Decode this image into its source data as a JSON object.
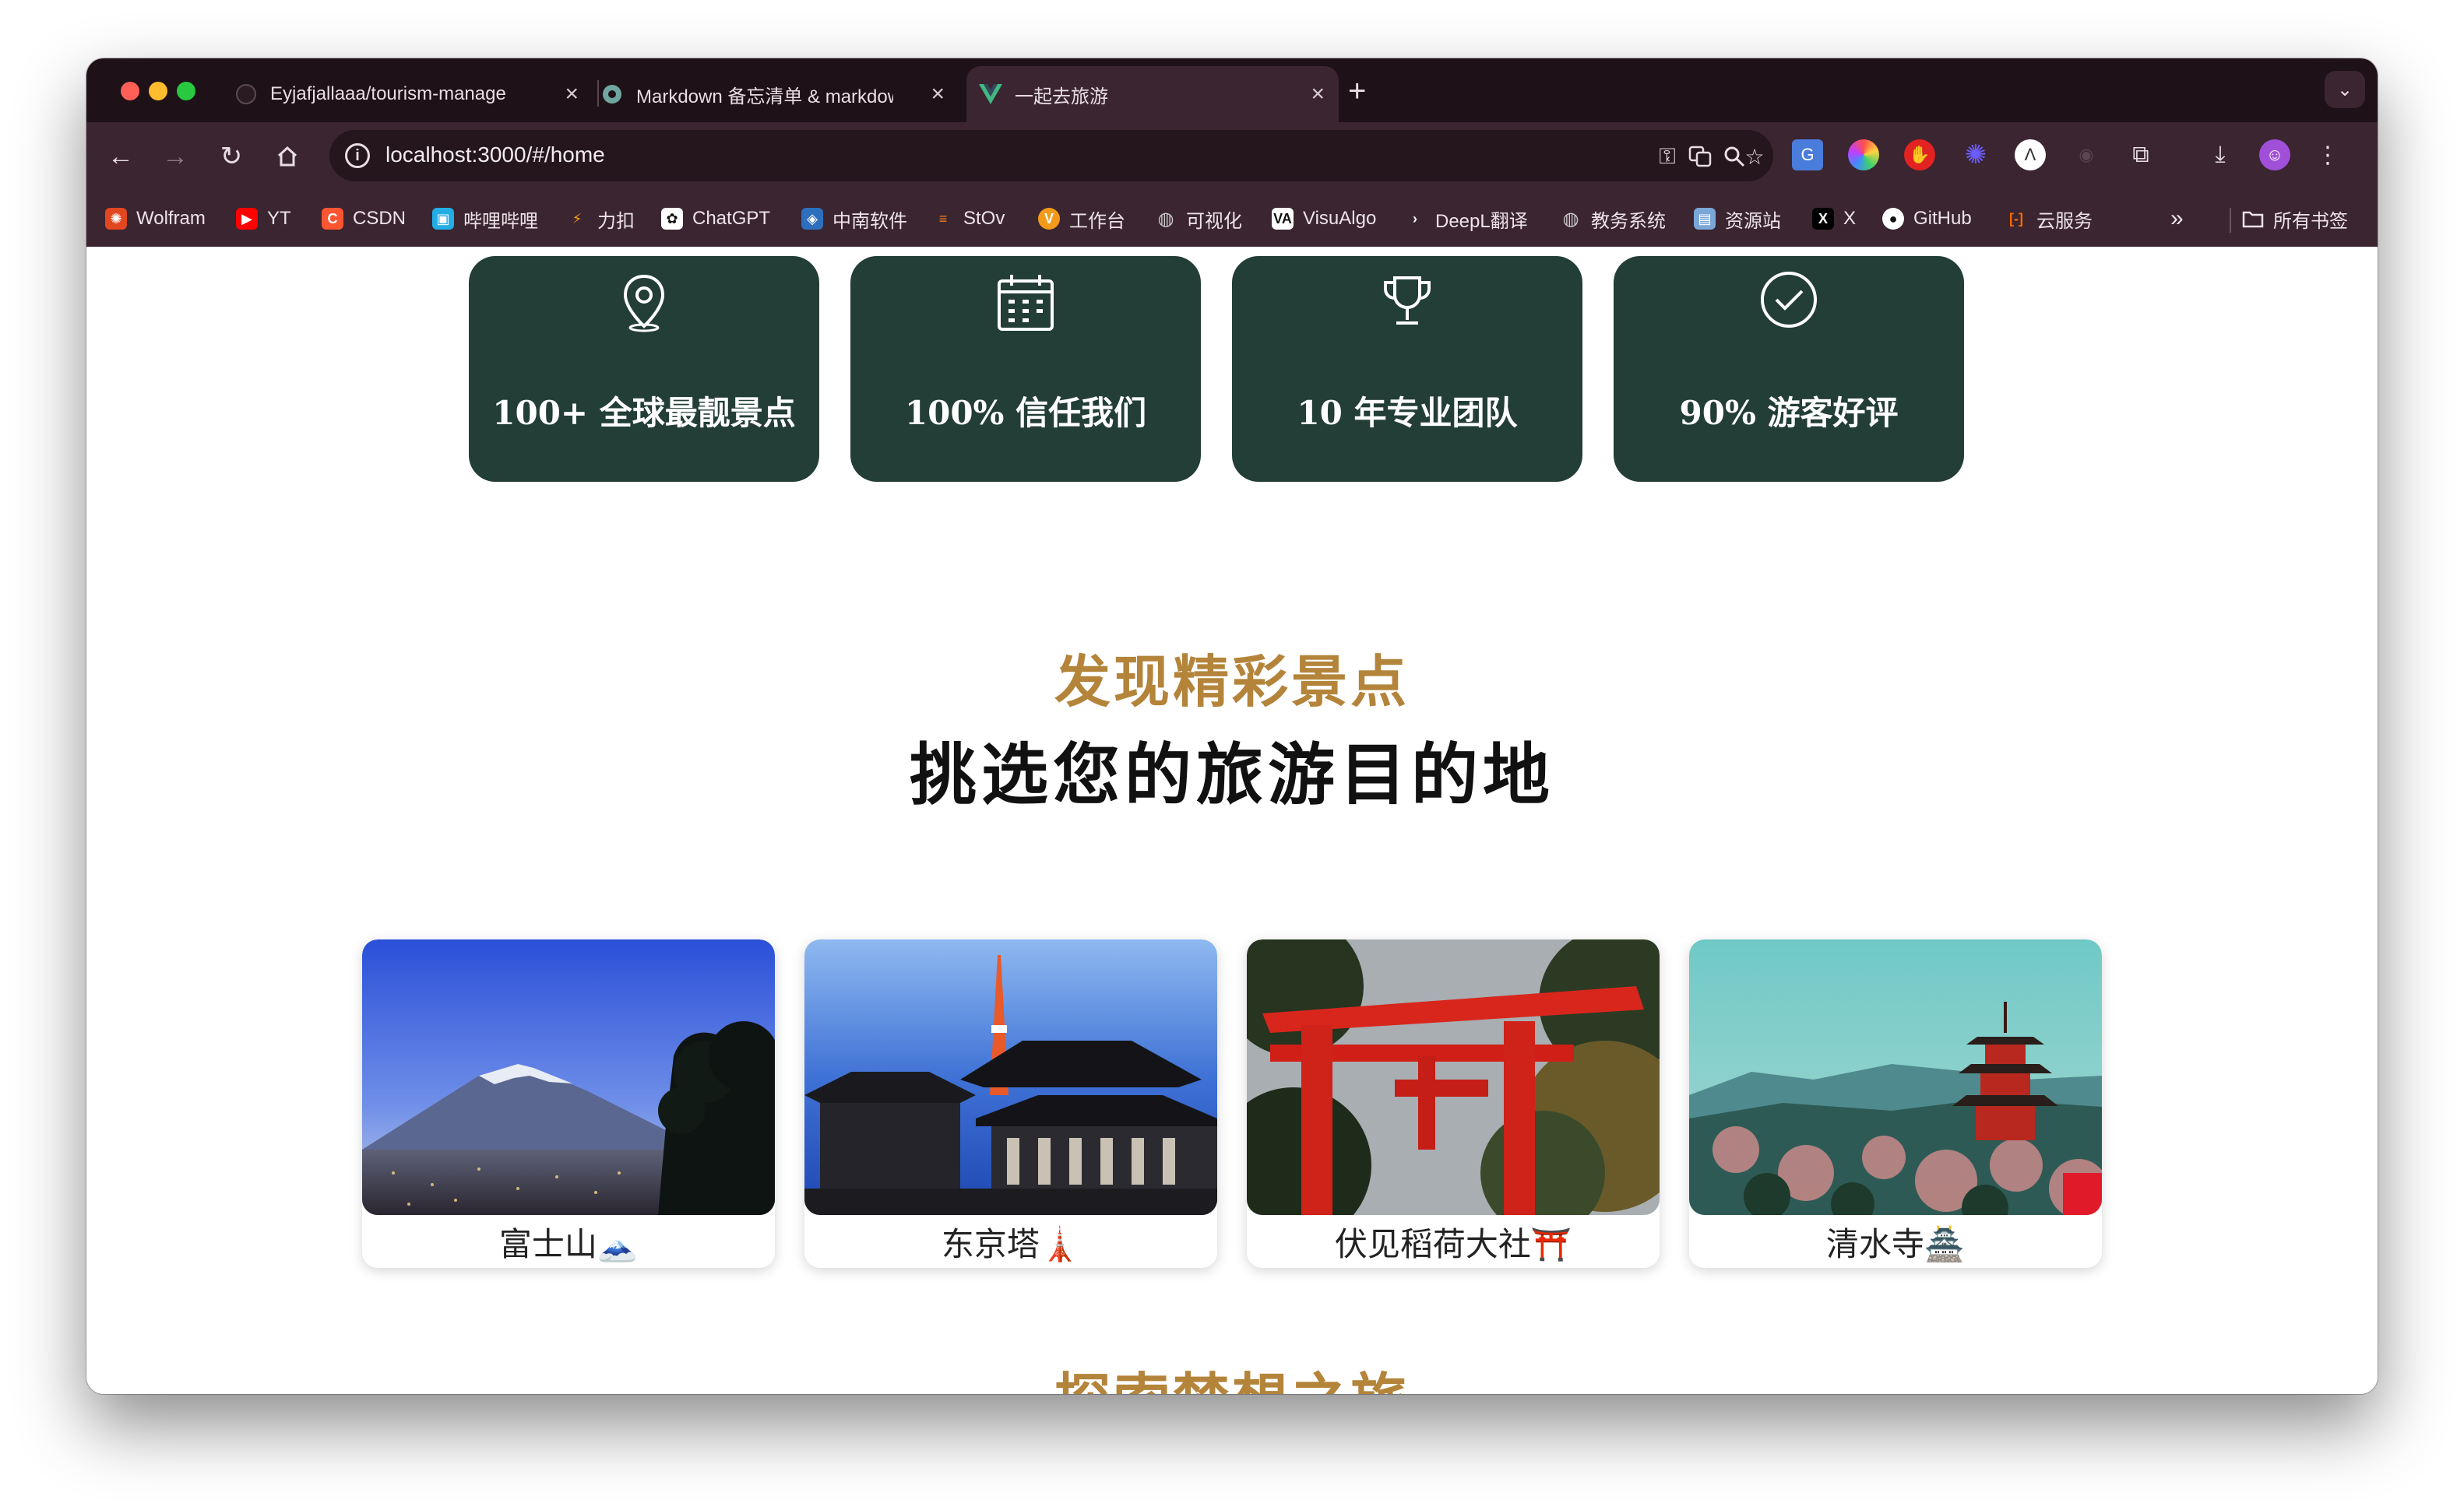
{
  "browser": {
    "tabs": [
      {
        "title": "Eyjafjallaaa/tourism-manage",
        "icon": "github-icon",
        "close": "×"
      },
      {
        "title": "Markdown 备忘清单 & markdown",
        "icon": "markdown-icon",
        "close": "×"
      },
      {
        "title": "一起去旅游",
        "icon": "vue-icon",
        "close": "×",
        "active": true
      }
    ],
    "new_tab": "+",
    "url": "localhost:3000/#/home",
    "bookmarks": [
      {
        "label": "Wolfram",
        "icon": "wolfram-icon",
        "color": "#e2471f"
      },
      {
        "label": "YT",
        "icon": "youtube-icon",
        "color": "#ff0000"
      },
      {
        "label": "CSDN",
        "icon": "csdn-icon",
        "color": "#fc5531"
      },
      {
        "label": "哔哩哔哩",
        "icon": "bilibili-icon",
        "color": "#23ade5"
      },
      {
        "label": "力扣",
        "icon": "leetcode-icon",
        "color": "#ffa116"
      },
      {
        "label": "ChatGPT",
        "icon": "chatgpt-icon",
        "color": "#ffffff"
      },
      {
        "label": "中南软件",
        "icon": "csu-icon",
        "color": "#2d6fbd"
      },
      {
        "label": "StOv",
        "icon": "stackoverflow-icon",
        "color": "#f48024"
      },
      {
        "label": "工作台",
        "icon": "workbench-icon",
        "color": "#f39a1a"
      },
      {
        "label": "可视化",
        "icon": "globe-icon",
        "color": "#cccccc"
      },
      {
        "label": "VisuAlgo",
        "icon": "visualgo-icon",
        "color": "#ffffff"
      },
      {
        "label": "DeepL翻译",
        "icon": "deepl-icon",
        "color": "#0f2b46"
      },
      {
        "label": "教务系统",
        "icon": "globe-icon",
        "color": "#cccccc"
      },
      {
        "label": "资源站",
        "icon": "resource-icon",
        "color": "#7aa7d8"
      },
      {
        "label": "X",
        "icon": "x-icon",
        "color": "#000000"
      },
      {
        "label": "GitHub",
        "icon": "github-icon",
        "color": "#ffffff"
      },
      {
        "label": "云服务",
        "icon": "cloud-icon",
        "color": "#ff6a00"
      }
    ],
    "more_bookmarks": "»",
    "all_bookmarks": "所有书签"
  },
  "stats": [
    {
      "icon": "location-pin-icon",
      "text": "100+ 全球最靓景点"
    },
    {
      "icon": "calendar-icon",
      "text": "100% 信任我们"
    },
    {
      "icon": "trophy-icon",
      "text": "10 年专业团队"
    },
    {
      "icon": "check-circle-icon",
      "text": "90% 游客好评"
    }
  ],
  "destinations_section": {
    "subtitle": "发现精彩景点",
    "title": "挑选您的旅游目的地"
  },
  "destinations": [
    {
      "name": "富士山🗻"
    },
    {
      "name": "东京塔🗼"
    },
    {
      "name": "伏见稻荷大社⛩️"
    },
    {
      "name": "清水寺🏯"
    }
  ],
  "explore_section": {
    "subtitle": "探索梦想之旅"
  },
  "colors": {
    "card_bg": "#233d37",
    "accent_gold": "#b3843a",
    "browser_frame": "#3a2530"
  }
}
